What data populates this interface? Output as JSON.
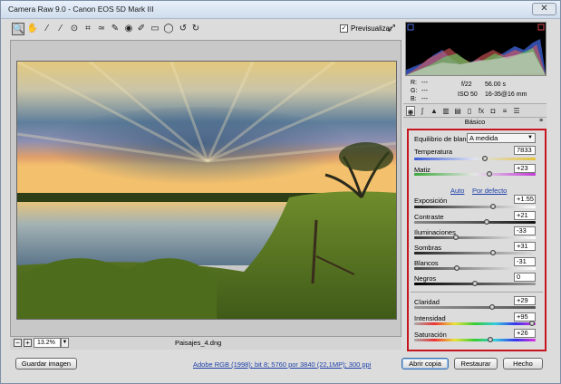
{
  "window": {
    "title": "Camera Raw 9.0  -  Canon EOS 5D Mark III"
  },
  "toolbar": {
    "tools": [
      "zoom-tool-icon",
      "hand-tool-icon",
      "white-balance-icon",
      "color-sampler-icon",
      "targeted-adjustment-icon",
      "crop-icon",
      "straighten-icon",
      "spot-removal-icon",
      "red-eye-icon",
      "adjustment-brush-icon",
      "graduated-filter-icon",
      "radial-filter-icon",
      "preferences-icon",
      "rotate-left-icon",
      "rotate-right-icon"
    ],
    "preview_label": "Previsualizar",
    "preview_checked": true
  },
  "preview": {
    "zoom": "13.2%",
    "filename": "Paisajes_4.dng"
  },
  "readout": {
    "r_label": "R:",
    "r_value": "---",
    "g_label": "G:",
    "g_value": "---",
    "b_label": "B:",
    "b_value": "---",
    "aperture": "f/22",
    "shutter": "56.00 s",
    "iso": "ISO 50",
    "lens": "16-35@16 mm"
  },
  "panel": {
    "name": "Básico"
  },
  "basic": {
    "wb_label": "Equilibrio de blancos:",
    "wb_value": "A medida",
    "auto_label": "Auto",
    "default_label": "Por defecto",
    "controls": {
      "temperature": {
        "label": "Temperatura",
        "value": "7833",
        "level": 0.58
      },
      "tint": {
        "label": "Matiz",
        "value": "+23",
        "level": 0.62
      },
      "exposure": {
        "label": "Exposición",
        "value": "+1.55",
        "level": 0.65
      },
      "contrast": {
        "label": "Contraste",
        "value": "+21",
        "level": 0.6
      },
      "highlights": {
        "label": "Iluminaciones",
        "value": "-33",
        "level": 0.34
      },
      "shadows": {
        "label": "Sombras",
        "value": "+31",
        "level": 0.65
      },
      "whites": {
        "label": "Blancos",
        "value": "-31",
        "level": 0.35
      },
      "blacks": {
        "label": "Negros",
        "value": "0",
        "level": 0.5
      },
      "clarity": {
        "label": "Claridad",
        "value": "+29",
        "level": 0.64
      },
      "vibrance": {
        "label": "Intensidad",
        "value": "+95",
        "level": 0.97
      },
      "saturation": {
        "label": "Saturación",
        "value": "+26",
        "level": 0.63
      }
    }
  },
  "footer": {
    "save": "Guardar imagen",
    "workflow": "Adobe RGB (1998); bit 8; 5760 por 3840 (22,1MP); 300 ppi",
    "open": "Abrir copia",
    "reset": "Restaurar",
    "done": "Hecho"
  },
  "colors": {
    "frame": "#c8141e",
    "link": "#1c3fa8"
  }
}
